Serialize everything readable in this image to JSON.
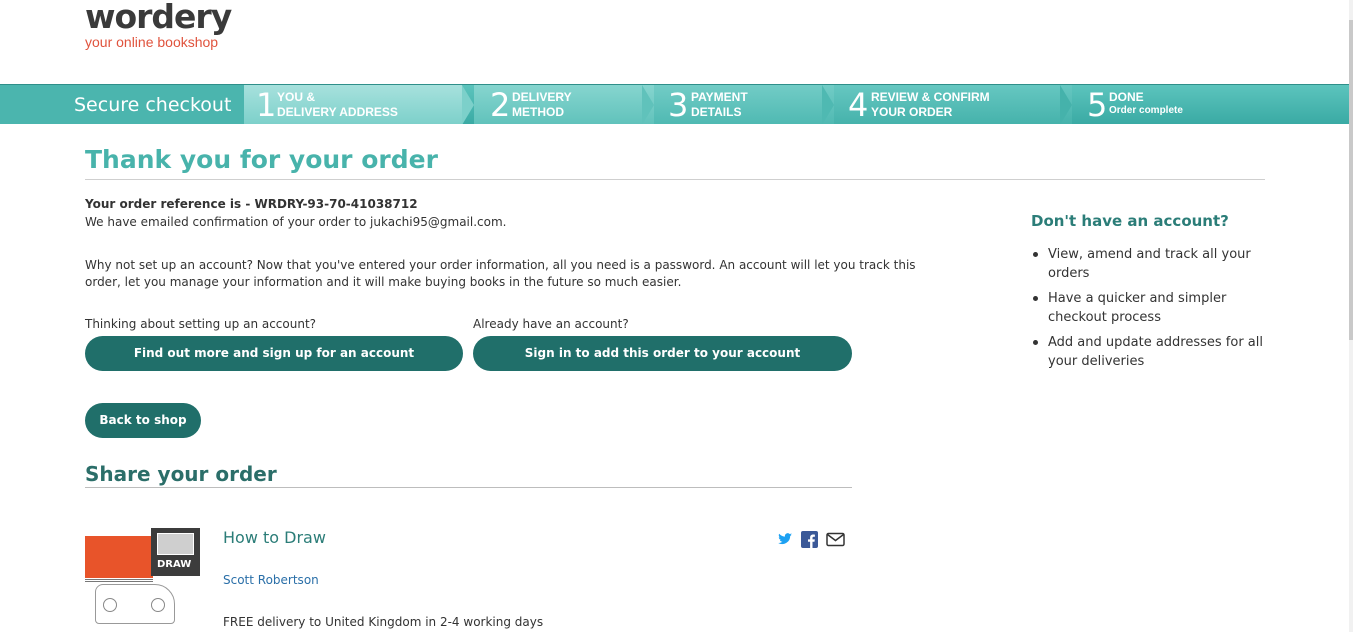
{
  "logo": {
    "wordmark": "wordery",
    "tagline": "your online bookshop"
  },
  "checkout": {
    "title": "Secure checkout",
    "steps": [
      {
        "num": "1",
        "line1": "YOU &",
        "line2": "DELIVERY ADDRESS"
      },
      {
        "num": "2",
        "line1": "DELIVERY",
        "line2": "METHOD"
      },
      {
        "num": "3",
        "line1": "PAYMENT",
        "line2": "DETAILS"
      },
      {
        "num": "4",
        "line1": "REVIEW & CONFIRM",
        "line2": "YOUR ORDER"
      },
      {
        "num": "5",
        "line1": "DONE",
        "line2": "Order complete"
      }
    ]
  },
  "main": {
    "title": "Thank you for your order",
    "order_ref": "Your order reference is - WRDRY-93-70-41038712",
    "email_confirm": "We have emailed confirmation of your order to jukachi95@gmail.com.",
    "account_pitch_1": "Why not set up an account? Now that you've entered your order information, all you need is a password. An account will let you track this",
    "account_pitch_2": "order, let you manage your information and it will make buying books in the future so much easier.",
    "signup_prompt": "Thinking about setting up an account?",
    "signin_prompt": "Already have an account?",
    "signup_button": "Find out more and sign up for an account",
    "signin_button": "Sign in to add this order to your account",
    "back_button": "Back to shop",
    "share_title": "Share your order"
  },
  "book": {
    "title": "How to Draw",
    "author": "Scott Robertson",
    "delivery": "FREE delivery to United Kingdom in 2-4 working days",
    "cover_text": "DRAW"
  },
  "social_icons": [
    "twitter-icon",
    "facebook-icon",
    "email-icon"
  ],
  "sidebar": {
    "title": "Don't have an account?",
    "items": [
      {
        "line1": "View, amend and track all your",
        "line2": "orders"
      },
      {
        "line1": "Have a quicker and simpler",
        "line2": "checkout process"
      },
      {
        "line1": "Add and update addresses for all",
        "line2": "your deliveries"
      }
    ]
  },
  "colors": {
    "teal_heading": "#48b3ab",
    "button": "#206f6a",
    "logo_tagline": "#e0533d",
    "twitter": "#1da1f2",
    "facebook": "#3b5998"
  }
}
